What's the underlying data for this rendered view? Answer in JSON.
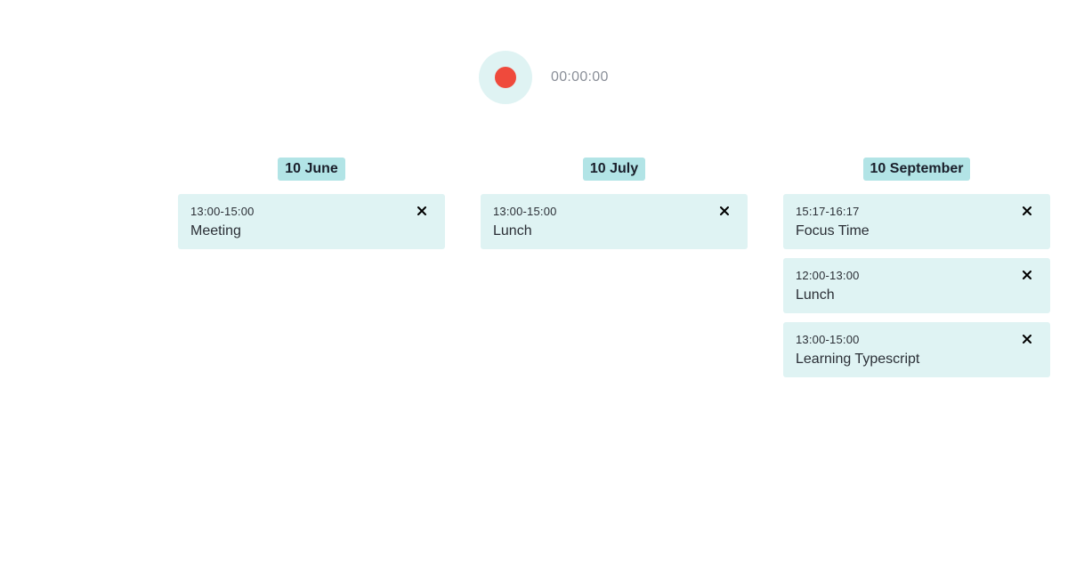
{
  "recorder": {
    "timer": "00:00:00",
    "colors": {
      "button_bg": "#dff3f3",
      "dot": "#ef4a3c"
    }
  },
  "days": [
    {
      "label": "10 June",
      "events": [
        {
          "time": "13:00-15:00",
          "title": "Meeting"
        }
      ]
    },
    {
      "label": "10 July",
      "events": [
        {
          "time": "13:00-15:00",
          "title": "Lunch"
        }
      ]
    },
    {
      "label": "10 September",
      "events": [
        {
          "time": "15:17-16:17",
          "title": "Focus Time"
        },
        {
          "time": "12:00-13:00",
          "title": "Lunch"
        },
        {
          "time": "13:00-15:00",
          "title": "Learning Typescript"
        }
      ]
    }
  ],
  "icons": {
    "close": "close-icon",
    "record": "record-icon"
  },
  "colors": {
    "card_bg": "#dff3f3",
    "label_bg": "#b2e4e6"
  }
}
